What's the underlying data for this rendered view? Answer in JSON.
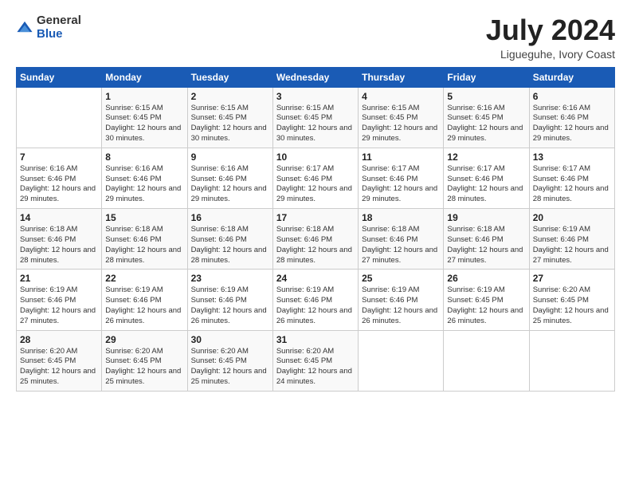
{
  "logo": {
    "general": "General",
    "blue": "Blue"
  },
  "header": {
    "month": "July 2024",
    "location": "Ligueguhe, Ivory Coast"
  },
  "days_of_week": [
    "Sunday",
    "Monday",
    "Tuesday",
    "Wednesday",
    "Thursday",
    "Friday",
    "Saturday"
  ],
  "weeks": [
    [
      {
        "day": "",
        "sunrise": "",
        "sunset": "",
        "daylight": ""
      },
      {
        "day": "1",
        "sunrise": "Sunrise: 6:15 AM",
        "sunset": "Sunset: 6:45 PM",
        "daylight": "Daylight: 12 hours and 30 minutes."
      },
      {
        "day": "2",
        "sunrise": "Sunrise: 6:15 AM",
        "sunset": "Sunset: 6:45 PM",
        "daylight": "Daylight: 12 hours and 30 minutes."
      },
      {
        "day": "3",
        "sunrise": "Sunrise: 6:15 AM",
        "sunset": "Sunset: 6:45 PM",
        "daylight": "Daylight: 12 hours and 30 minutes."
      },
      {
        "day": "4",
        "sunrise": "Sunrise: 6:15 AM",
        "sunset": "Sunset: 6:45 PM",
        "daylight": "Daylight: 12 hours and 29 minutes."
      },
      {
        "day": "5",
        "sunrise": "Sunrise: 6:16 AM",
        "sunset": "Sunset: 6:45 PM",
        "daylight": "Daylight: 12 hours and 29 minutes."
      },
      {
        "day": "6",
        "sunrise": "Sunrise: 6:16 AM",
        "sunset": "Sunset: 6:46 PM",
        "daylight": "Daylight: 12 hours and 29 minutes."
      }
    ],
    [
      {
        "day": "7",
        "sunrise": "Sunrise: 6:16 AM",
        "sunset": "Sunset: 6:46 PM",
        "daylight": "Daylight: 12 hours and 29 minutes."
      },
      {
        "day": "8",
        "sunrise": "Sunrise: 6:16 AM",
        "sunset": "Sunset: 6:46 PM",
        "daylight": "Daylight: 12 hours and 29 minutes."
      },
      {
        "day": "9",
        "sunrise": "Sunrise: 6:16 AM",
        "sunset": "Sunset: 6:46 PM",
        "daylight": "Daylight: 12 hours and 29 minutes."
      },
      {
        "day": "10",
        "sunrise": "Sunrise: 6:17 AM",
        "sunset": "Sunset: 6:46 PM",
        "daylight": "Daylight: 12 hours and 29 minutes."
      },
      {
        "day": "11",
        "sunrise": "Sunrise: 6:17 AM",
        "sunset": "Sunset: 6:46 PM",
        "daylight": "Daylight: 12 hours and 29 minutes."
      },
      {
        "day": "12",
        "sunrise": "Sunrise: 6:17 AM",
        "sunset": "Sunset: 6:46 PM",
        "daylight": "Daylight: 12 hours and 28 minutes."
      },
      {
        "day": "13",
        "sunrise": "Sunrise: 6:17 AM",
        "sunset": "Sunset: 6:46 PM",
        "daylight": "Daylight: 12 hours and 28 minutes."
      }
    ],
    [
      {
        "day": "14",
        "sunrise": "Sunrise: 6:18 AM",
        "sunset": "Sunset: 6:46 PM",
        "daylight": "Daylight: 12 hours and 28 minutes."
      },
      {
        "day": "15",
        "sunrise": "Sunrise: 6:18 AM",
        "sunset": "Sunset: 6:46 PM",
        "daylight": "Daylight: 12 hours and 28 minutes."
      },
      {
        "day": "16",
        "sunrise": "Sunrise: 6:18 AM",
        "sunset": "Sunset: 6:46 PM",
        "daylight": "Daylight: 12 hours and 28 minutes."
      },
      {
        "day": "17",
        "sunrise": "Sunrise: 6:18 AM",
        "sunset": "Sunset: 6:46 PM",
        "daylight": "Daylight: 12 hours and 28 minutes."
      },
      {
        "day": "18",
        "sunrise": "Sunrise: 6:18 AM",
        "sunset": "Sunset: 6:46 PM",
        "daylight": "Daylight: 12 hours and 27 minutes."
      },
      {
        "day": "19",
        "sunrise": "Sunrise: 6:18 AM",
        "sunset": "Sunset: 6:46 PM",
        "daylight": "Daylight: 12 hours and 27 minutes."
      },
      {
        "day": "20",
        "sunrise": "Sunrise: 6:19 AM",
        "sunset": "Sunset: 6:46 PM",
        "daylight": "Daylight: 12 hours and 27 minutes."
      }
    ],
    [
      {
        "day": "21",
        "sunrise": "Sunrise: 6:19 AM",
        "sunset": "Sunset: 6:46 PM",
        "daylight": "Daylight: 12 hours and 27 minutes."
      },
      {
        "day": "22",
        "sunrise": "Sunrise: 6:19 AM",
        "sunset": "Sunset: 6:46 PM",
        "daylight": "Daylight: 12 hours and 26 minutes."
      },
      {
        "day": "23",
        "sunrise": "Sunrise: 6:19 AM",
        "sunset": "Sunset: 6:46 PM",
        "daylight": "Daylight: 12 hours and 26 minutes."
      },
      {
        "day": "24",
        "sunrise": "Sunrise: 6:19 AM",
        "sunset": "Sunset: 6:46 PM",
        "daylight": "Daylight: 12 hours and 26 minutes."
      },
      {
        "day": "25",
        "sunrise": "Sunrise: 6:19 AM",
        "sunset": "Sunset: 6:46 PM",
        "daylight": "Daylight: 12 hours and 26 minutes."
      },
      {
        "day": "26",
        "sunrise": "Sunrise: 6:19 AM",
        "sunset": "Sunset: 6:45 PM",
        "daylight": "Daylight: 12 hours and 26 minutes."
      },
      {
        "day": "27",
        "sunrise": "Sunrise: 6:20 AM",
        "sunset": "Sunset: 6:45 PM",
        "daylight": "Daylight: 12 hours and 25 minutes."
      }
    ],
    [
      {
        "day": "28",
        "sunrise": "Sunrise: 6:20 AM",
        "sunset": "Sunset: 6:45 PM",
        "daylight": "Daylight: 12 hours and 25 minutes."
      },
      {
        "day": "29",
        "sunrise": "Sunrise: 6:20 AM",
        "sunset": "Sunset: 6:45 PM",
        "daylight": "Daylight: 12 hours and 25 minutes."
      },
      {
        "day": "30",
        "sunrise": "Sunrise: 6:20 AM",
        "sunset": "Sunset: 6:45 PM",
        "daylight": "Daylight: 12 hours and 25 minutes."
      },
      {
        "day": "31",
        "sunrise": "Sunrise: 6:20 AM",
        "sunset": "Sunset: 6:45 PM",
        "daylight": "Daylight: 12 hours and 24 minutes."
      },
      {
        "day": "",
        "sunrise": "",
        "sunset": "",
        "daylight": ""
      },
      {
        "day": "",
        "sunrise": "",
        "sunset": "",
        "daylight": ""
      },
      {
        "day": "",
        "sunrise": "",
        "sunset": "",
        "daylight": ""
      }
    ]
  ]
}
